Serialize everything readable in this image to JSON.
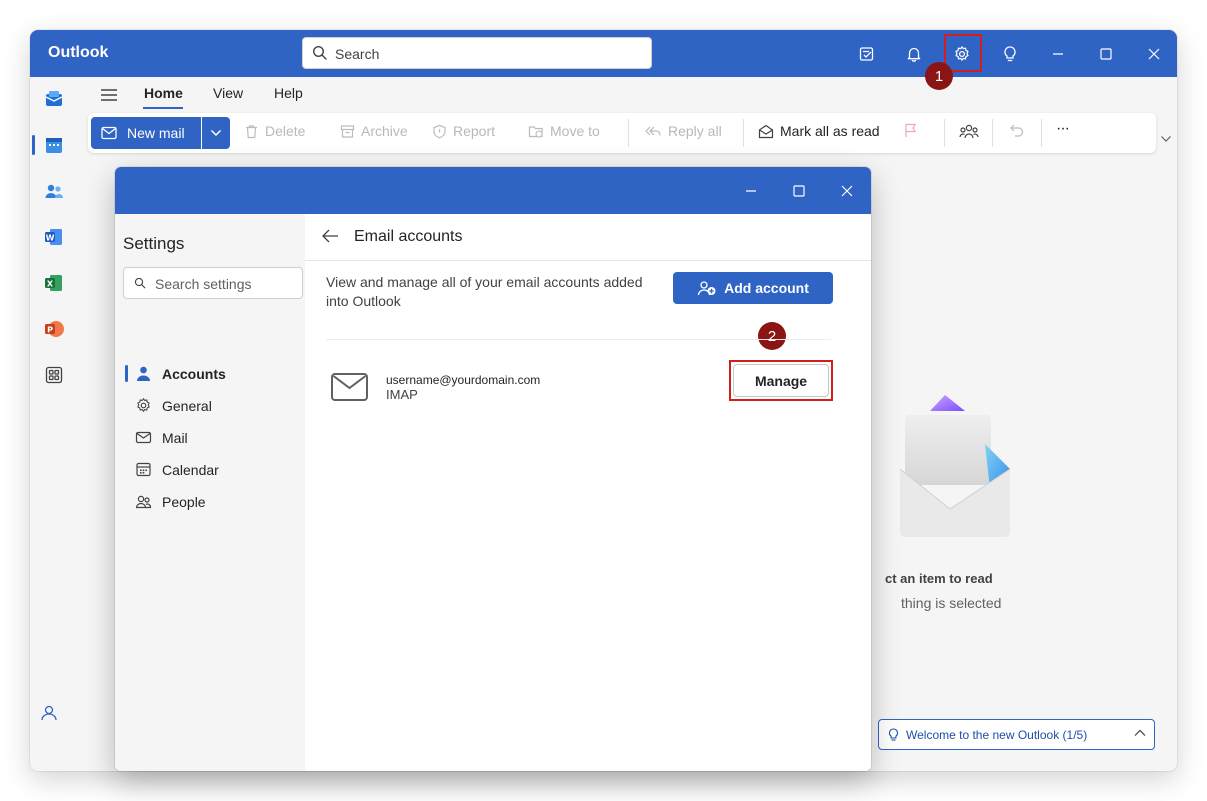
{
  "app": {
    "name": "Outlook"
  },
  "search": {
    "placeholder": "Search"
  },
  "annotations": {
    "step1": "1",
    "step2": "2"
  },
  "menu": {
    "tabs": [
      {
        "label": "Home"
      },
      {
        "label": "View"
      },
      {
        "label": "Help"
      }
    ]
  },
  "ribbon": {
    "new_mail": "New mail",
    "delete": "Delete",
    "archive": "Archive",
    "report": "Report",
    "move_to": "Move to",
    "reply_all": "Reply all",
    "mark_all_as_read": "Mark all as read",
    "more": "···"
  },
  "reading_pane": {
    "title": "ct an item to read",
    "subtitle": "thing is selected"
  },
  "welcome": {
    "label": "Welcome to the new Outlook  (1/5)"
  },
  "settings": {
    "title": "Settings",
    "search_placeholder": "Search settings",
    "nav": [
      {
        "label": "Accounts",
        "icon": "person-icon",
        "selected": true
      },
      {
        "label": "General",
        "icon": "gear-icon"
      },
      {
        "label": "Mail",
        "icon": "mail-icon"
      },
      {
        "label": "Calendar",
        "icon": "calendar-icon"
      },
      {
        "label": "People",
        "icon": "people-icon"
      }
    ],
    "pane_title": "Email accounts",
    "description": "View and manage all of your email accounts added into Outlook",
    "add_account": "Add account",
    "account": {
      "email": "username@yourdomain.com",
      "type": "IMAP"
    },
    "manage": "Manage"
  },
  "colors": {
    "brand": "#2f63c4",
    "annotation": "#d11f1f",
    "badge": "#8b1414"
  }
}
